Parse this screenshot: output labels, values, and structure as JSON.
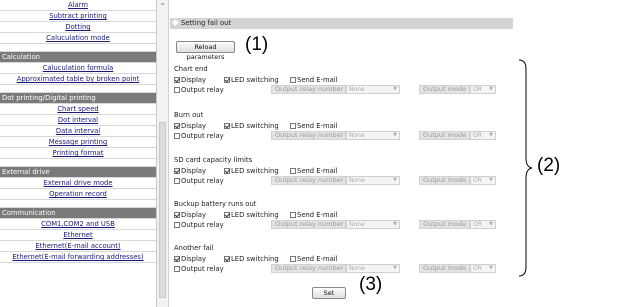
{
  "sidebar": {
    "items": [
      {
        "type": "link",
        "label": "Alarm"
      },
      {
        "type": "link",
        "label": "Subtract printing"
      },
      {
        "type": "link",
        "label": "Dotting"
      },
      {
        "type": "link",
        "label": "Caluculation mode"
      },
      {
        "type": "spacer"
      },
      {
        "type": "header",
        "label": "Calculation"
      },
      {
        "type": "link",
        "label": "Caluculation formula"
      },
      {
        "type": "link",
        "label": "Approximated table by broken point"
      },
      {
        "type": "spacer"
      },
      {
        "type": "header",
        "label": "Dot printing/Digital printing"
      },
      {
        "type": "link",
        "label": "Chart speed"
      },
      {
        "type": "link",
        "label": "Dot interval"
      },
      {
        "type": "link",
        "label": "Data interval"
      },
      {
        "type": "link",
        "label": "Message printing"
      },
      {
        "type": "link",
        "label": "Printing format"
      },
      {
        "type": "spacer"
      },
      {
        "type": "header",
        "label": "External drive"
      },
      {
        "type": "link",
        "label": "External drive mode"
      },
      {
        "type": "link",
        "label": "Operation record"
      },
      {
        "type": "spacer"
      },
      {
        "type": "header",
        "label": "Communication"
      },
      {
        "type": "link",
        "label": "COM1,COM2 and USB"
      },
      {
        "type": "link",
        "label": "Ethernet"
      },
      {
        "type": "link",
        "label": "Ethernet(E-mail account)"
      },
      {
        "type": "link",
        "label": "Ethernet(E-mail forwarding addresses)"
      }
    ]
  },
  "main": {
    "section_title": "Setting fail out",
    "reload_button": "Reload parameters",
    "set_button": "Set",
    "callouts": {
      "c1": "(1)",
      "c2": "(2)",
      "c3": "(3)"
    },
    "option_labels": {
      "display": "Display",
      "led": "LED switching",
      "email": "Send E-mail",
      "relay": "Output relay",
      "relay_number": "Output relay number",
      "output_mode": "Output mode"
    },
    "groups": [
      {
        "title": "Chart end",
        "display": true,
        "led": true,
        "email": false,
        "relay": false,
        "relay_number": "None",
        "output_mode": "OR"
      },
      {
        "title": "Burn out",
        "display": true,
        "led": true,
        "email": false,
        "relay": false,
        "relay_number": "None",
        "output_mode": "OR"
      },
      {
        "title": "SD card capacity limits",
        "display": true,
        "led": true,
        "email": false,
        "relay": false,
        "relay_number": "None",
        "output_mode": "OR"
      },
      {
        "title": "Buckup battery runs out",
        "display": true,
        "led": true,
        "email": false,
        "relay": false,
        "relay_number": "None",
        "output_mode": "OR"
      },
      {
        "title": "Another fail",
        "display": true,
        "led": true,
        "email": false,
        "relay": false,
        "relay_number": "None",
        "output_mode": "OR"
      }
    ]
  }
}
